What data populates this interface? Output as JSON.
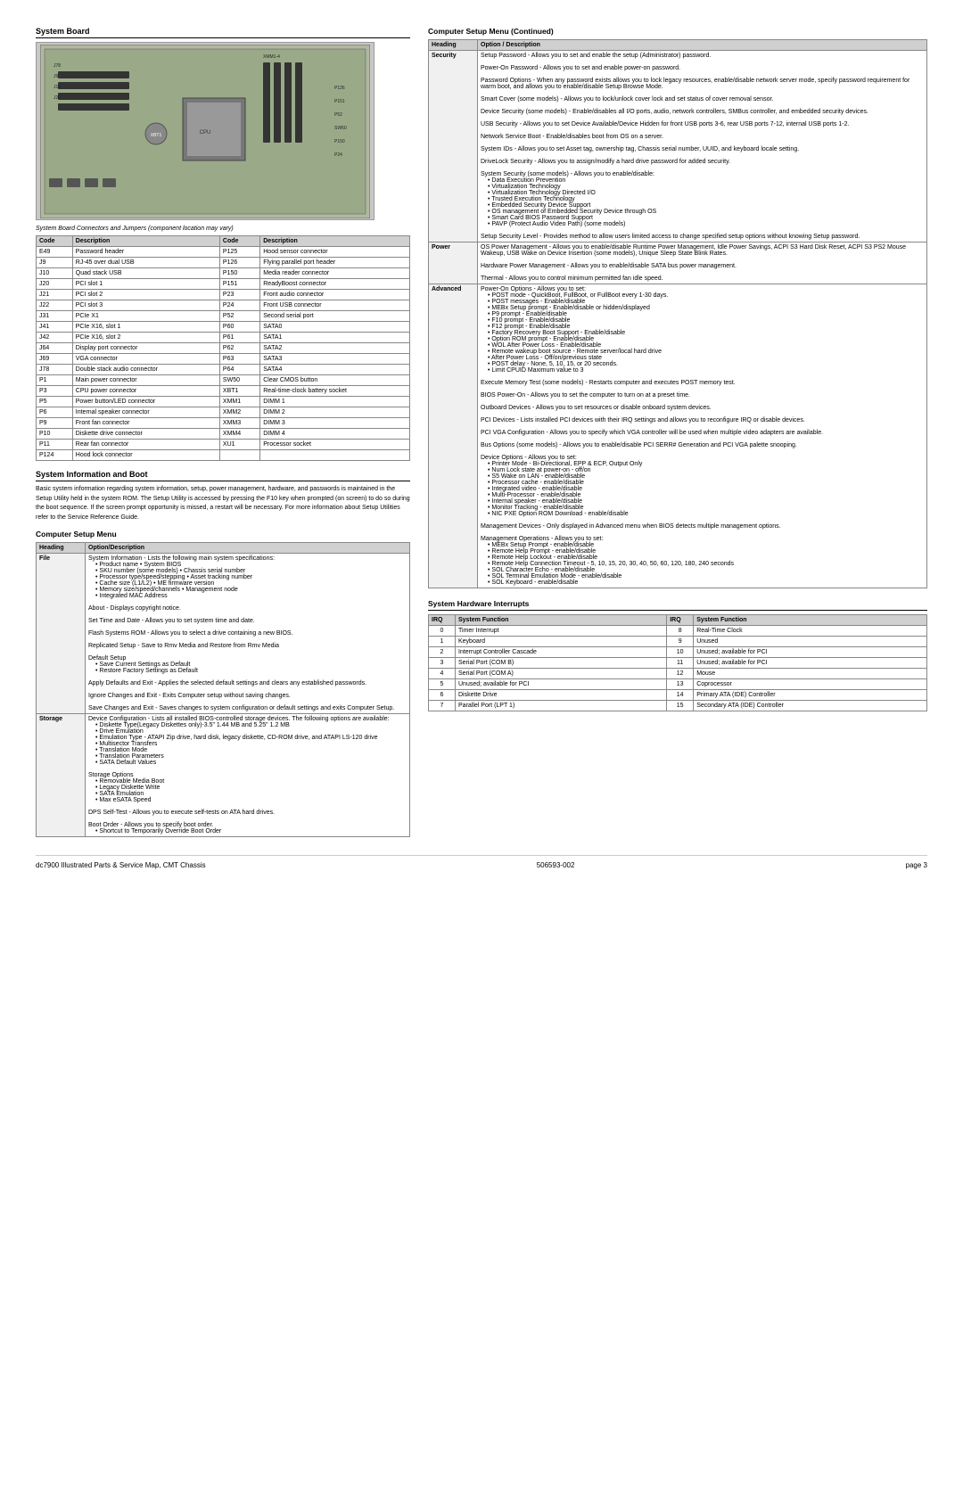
{
  "page": {
    "title": "dc7900 Illustrated Parts & Service Map, CMT Chassis",
    "part_number": "506593-002",
    "page_number": "page 3"
  },
  "system_board_section": {
    "title": "System Board",
    "note": "System Board Connectors and Jumpers (component location may vary)"
  },
  "connectors": [
    {
      "code": "E49",
      "description": "Password header",
      "code2": "P125",
      "description2": "Hood sensor connector"
    },
    {
      "code": "J9",
      "description": "RJ-45 over dual USB",
      "code2": "P126",
      "description2": "Flying parallel port header"
    },
    {
      "code": "J10",
      "description": "Quad stack USB",
      "code2": "P150",
      "description2": "Media reader connector"
    },
    {
      "code": "J20",
      "description": "PCI slot 1",
      "code2": "P151",
      "description2": "ReadyBoost connector"
    },
    {
      "code": "J21",
      "description": "PCI slot 2",
      "code2": "P23",
      "description2": "Front audio connector"
    },
    {
      "code": "J22",
      "description": "PCI slot 3",
      "code2": "P24",
      "description2": "Front USB connector"
    },
    {
      "code": "J31",
      "description": "PCIe X1",
      "code2": "P52",
      "description2": "Second serial port"
    },
    {
      "code": "J41",
      "description": "PCIe X16, slot 1",
      "code2": "P60",
      "description2": "SATA0"
    },
    {
      "code": "J42",
      "description": "PCIe X16, slot 2",
      "code2": "P61",
      "description2": "SATA1"
    },
    {
      "code": "J64",
      "description": "Display port connector",
      "code2": "P62",
      "description2": "SATA2"
    },
    {
      "code": "J69",
      "description": "VGA connector",
      "code2": "P63",
      "description2": "SATA3"
    },
    {
      "code": "J78",
      "description": "Double stack audio connector",
      "code2": "P64",
      "description2": "SATA4"
    },
    {
      "code": "P1",
      "description": "Main power connector",
      "code2": "SW50",
      "description2": "Clear CMOS button"
    },
    {
      "code": "P3",
      "description": "CPU power connector",
      "code2": "XBT1",
      "description2": "Real-time-clock battery socket"
    },
    {
      "code": "P5",
      "description": "Power button/LED connector",
      "code2": "XMM1",
      "description2": "DIMM 1"
    },
    {
      "code": "P6",
      "description": "Internal speaker connector",
      "code2": "XMM2",
      "description2": "DIMM 2"
    },
    {
      "code": "P9",
      "description": "Front fan connector",
      "code2": "XMM3",
      "description2": "DIMM 3"
    },
    {
      "code": "P10",
      "description": "Diskette drive connector",
      "code2": "XMM4",
      "description2": "DIMM 4"
    },
    {
      "code": "P11",
      "description": "Rear fan connector",
      "code2": "XU1",
      "description2": "Processor socket"
    },
    {
      "code": "P124",
      "description": "Hood lock connector",
      "code2": "",
      "description2": ""
    }
  ],
  "system_setup_section": {
    "title": "System Information and Boot",
    "description": "Basic system information regarding system information, setup, power management, hardware, and passwords is maintained in the Setup Utility held in the system ROM. The Setup Utility is accessed by pressing the F10 key when prompted (on screen) to do so during the boot sequence. If the screen prompt opportunity is missed, a restart will be necessary. For more information about Setup Utilities refer to the Service Reference Guide."
  },
  "computer_setup_menu": {
    "title": "Computer Setup Menu",
    "col_heading": "Heading",
    "col_option": "Option/Description",
    "rows": [
      {
        "heading": "File",
        "options": [
          "System Information - Lists the following main system specifications:",
          "• Product name    • System BIOS",
          "• SKU number (some models)    • Chassis serial number",
          "• Processor type/speed/stepping    • Asset tracking number",
          "• Cache size (L1/L2)    • ME firmware version",
          "• Memory size/speed/channels    • Management node",
          "• Integrated MAC Address",
          "",
          "About - Displays copyright notice.",
          "",
          "Set Time and Date - Allows you to set system time and date.",
          "",
          "Flash Systems ROM - Allows you to select a drive containing a new BIOS.",
          "",
          "Replicated Setup - Save to Rmv Media and Restore from Rmv Media",
          "",
          "Default Setup",
          "• Save Current Settings as Default",
          "• Restore Factory Settings as Default",
          "",
          "Apply Defaults and Exit - Applies the selected default settings and clears any established passwords.",
          "",
          "Ignore Changes and Exit - Exits Computer setup without saving changes.",
          "",
          "Save Changes and Exit - Saves changes to system configuration or default settings and exits Computer Setup."
        ]
      },
      {
        "heading": "Storage",
        "options": [
          "Device Configuration - Lists all installed BIOS-controlled storage devices. The following options are available:",
          "• Diskette Type(Legacy Diskettes only)-3.5\" 1.44 MB and 5.25\" 1.2 MB",
          "• Drive Emulation",
          "• Emulation Type - ATAPI Zip drive, hard disk, legacy diskette, CD-ROM drive, and ATAPI LS-120 drive",
          "• Multisector Transfers",
          "• Translation Mode",
          "• Translation Parameters",
          "• SATA Default Values",
          "",
          "Storage Options",
          "• Removable Media Boot",
          "• Legacy Diskette Write",
          "• SATA Emulation",
          "• Max eSATA Speed",
          "",
          "DPS Self-Test - Allows you to execute self-tests on ATA hard drives.",
          "",
          "Boot Order - Allows you to specify boot order.",
          "• Shortcut to Temporarily Override Boot Order"
        ]
      }
    ]
  },
  "computer_setup_continued": {
    "title": "Computer Setup Menu (Continued)",
    "col_heading": "Heading",
    "col_option": "Option / Description",
    "rows": [
      {
        "heading": "Security",
        "options": [
          "Setup Password - Allows you to set and enable the setup (Administrator) password.",
          "",
          "Power-On Password - Allows you to set and enable power-on password.",
          "",
          "Password Options - When any password exists allows you to lock legacy resources, enable/disable network server mode, specify password requirement for warm boot, and allows you to enable/disable Setup Browse Mode.",
          "",
          "Smart Cover (some models) - Allows you to lock/unlock cover lock and set status of cover removal sensor.",
          "",
          "Device Security (some models) - Enable/disables all I/O ports, audio, network controllers, SMBus controller, and embedded security devices.",
          "",
          "USB Security - Allows you to set Device Available/Device Hidden for front USB ports 3-6, rear USB ports 7-12, internal USB ports 1-2.",
          "",
          "Network Service Boot - Enable/disables boot from OS on a server.",
          "",
          "System IDs - Allows you to set Asset tag, ownership tag, Chassis serial number, UUID, and keyboard locale setting.",
          "",
          "DriveLock Security - Allows you to assign/modify a hard drive password for added security.",
          "",
          "System Security (some models) - Allows you to enable/disable:",
          "• Data Execution Prevention",
          "• Virtualization Technology",
          "• Virtualization Technology Directed I/O",
          "• Trusted Execution Technology",
          "• Embedded Security Device Support",
          "• OS management of Embedded Security Device through OS",
          "• Smart Card BIOS Password Support",
          "• PAVP (Protect Audio Video Path) (some models)",
          "",
          "Setup Security Level - Provides method to allow users limited access to change specified setup options without knowing Setup password."
        ]
      },
      {
        "heading": "Power",
        "options": [
          "OS Power Management - Allows you to enable/disable Runtime Power Management, Idle Power Savings, ACPI S3 Hard Disk Reset, ACPI S3 PS2 Mouse Wakeup, USB Wake on Device Insertion (some models), Unique Sleep State Blink Rates.",
          "",
          "Hardware Power Management - Allows you to enable/disable SATA bus power management.",
          "",
          "Thermal - Allows you to control minimum permitted fan idle speed."
        ]
      },
      {
        "heading": "Advanced",
        "options": [
          "Power-On Options - Allows you to set:",
          "• POST mode - QuickBoot, FullBoot, or FullBoot every 1-30 days.",
          "• POST messages - Enable/disable",
          "• MEBx Setup prompt - Enable/disable or hidden/displayed",
          "• P9 prompt - Enable/disable",
          "• F10 prompt - Enable/disable",
          "• F12 prompt - Enable/disable",
          "• Factory Recovery Boot Support - Enable/disable",
          "• Option ROM prompt - Enable/disable",
          "• WOL After Power Loss - Enable/disable",
          "• Remote wakeup boot source - Remote server/local hard drive",
          "• After Power Loss - Off/on/previous state",
          "• POST delay - None, 5, 10, 15, or 20 seconds.",
          "• Limit CPUID Maximum value to 3",
          "",
          "Execute Memory Test (some models) - Restarts computer and executes POST memory test.",
          "",
          "BIOS Power-On - Allows you to set the computer to turn on at a preset time.",
          "",
          "Outboard Devices - Allows you to set resources or disable onboard system devices.",
          "",
          "PCI Devices - Lists installed PCI devices with their IRQ settings and allows you to reconfigure IRQ or disable devices.",
          "",
          "PCI VGA Configuration - Allows you to specify which VGA controller will be used when multiple video adapters are available.",
          "",
          "Bus Options (some models) - Allows you to enable/disable PCI SERR# Generation and PCI VGA palette snooping.",
          "",
          "Device Options - Allows you to set:",
          "• Printer Mode - Bi-Directional, EPP & ECP, Output Only",
          "• Num Lock state at power-on - off/on",
          "• S5 Wake on LAN - enable/disable",
          "• Processor cache - enable/disable",
          "• Integrated video - enable/disable",
          "• Multi-Processor - enable/disable",
          "• Internal speaker - enable/disable",
          "• Monitor Tracking - enable/disable",
          "• NIC PXE Option ROM Download - enable/disable",
          "",
          "Management Devices - Only displayed in Advanced menu when BIOS detects multiple management options.",
          "",
          "Management Operations - Allows you to set:",
          "• MEBx Setup Prompt - enable/disable",
          "• Remote Help Prompt - enable/disable",
          "• Remote Help Lockout - enable/disable",
          "• Remote Help Connection Timeout - 5, 10, 15, 20, 30, 40, 50, 60, 120, 180, 240 seconds",
          "• SOL Character Echo - enable/disable",
          "• SOL Terminal Emulation Mode - enable/disable",
          "• SOL Keyboard - enable/disable"
        ]
      }
    ]
  },
  "irq_section": {
    "title": "System Hardware Interrupts",
    "col_irq1": "IRQ",
    "col_func1": "System Function",
    "col_irq2": "IRQ",
    "col_func2": "System Function",
    "rows": [
      {
        "irq1": "0",
        "func1": "Timer Interrupt",
        "irq2": "8",
        "func2": "Real-Time Clock"
      },
      {
        "irq1": "1",
        "func1": "Keyboard",
        "irq2": "9",
        "func2": "Unused"
      },
      {
        "irq1": "2",
        "func1": "Interrupt Controller Cascade",
        "irq2": "10",
        "func2": "Unused; available for PCI"
      },
      {
        "irq1": "3",
        "func1": "Serial Port (COM B)",
        "irq2": "11",
        "func2": "Unused; available for PCI"
      },
      {
        "irq1": "4",
        "func1": "Serial Port (COM A)",
        "irq2": "12",
        "func2": "Mouse"
      },
      {
        "irq1": "5",
        "func1": "Unused; available for PCI",
        "irq2": "13",
        "func2": "Coprocessor"
      },
      {
        "irq1": "6",
        "func1": "Diskette Drive",
        "irq2": "14",
        "func2": "Primary ATA (IDE) Controller"
      },
      {
        "irq1": "7",
        "func1": "Parallel Port (LPT 1)",
        "irq2": "15",
        "func2": "Secondary ATA (IDE) Controller"
      }
    ]
  }
}
